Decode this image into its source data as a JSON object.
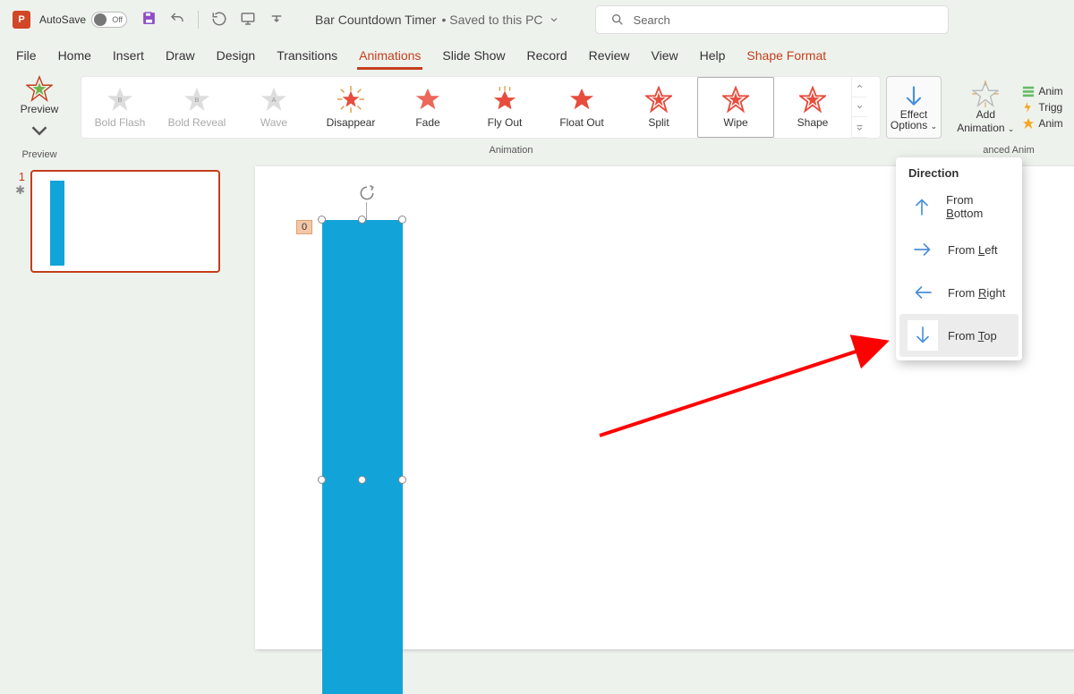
{
  "app": {
    "letter": "P"
  },
  "titlebar": {
    "autosave_label": "AutoSave",
    "autosave_state": "Off",
    "doc_name": "Bar Countdown Timer",
    "saved_text": "• Saved to this PC",
    "search_placeholder": "Search"
  },
  "tabs": [
    "File",
    "Home",
    "Insert",
    "Draw",
    "Design",
    "Transitions",
    "Animations",
    "Slide Show",
    "Record",
    "Review",
    "View",
    "Help",
    "Shape Format"
  ],
  "active_tab": "Animations",
  "contextual_tab": "Shape Format",
  "ribbon": {
    "preview": "Preview",
    "preview_group": "Preview",
    "anim_group": "Animation",
    "gallery": [
      "Bold Flash",
      "Bold Reveal",
      "Wave",
      "Disappear",
      "Fade",
      "Fly Out",
      "Float Out",
      "Split",
      "Wipe",
      "Shape"
    ],
    "selected": "Wipe",
    "dim": [
      "Bold Flash",
      "Bold Reveal",
      "Wave"
    ],
    "effect_options": "Effect Options",
    "add_anim": "Add Animation",
    "mini": [
      "Anim",
      "Trigg",
      "Anim"
    ],
    "adv_group": "anced Anim"
  },
  "thumbs": {
    "num": "1",
    "star": "★"
  },
  "canvas": {
    "zero": "0"
  },
  "dropdown": {
    "title": "Direction",
    "items": [
      {
        "label": "From Bottom",
        "accel": "B",
        "dir": "up"
      },
      {
        "label": "From Left",
        "accel": "L",
        "dir": "right"
      },
      {
        "label": "From Right",
        "accel": "R",
        "dir": "left"
      },
      {
        "label": "From Top",
        "accel": "T",
        "dir": "down",
        "hover": true
      }
    ]
  }
}
